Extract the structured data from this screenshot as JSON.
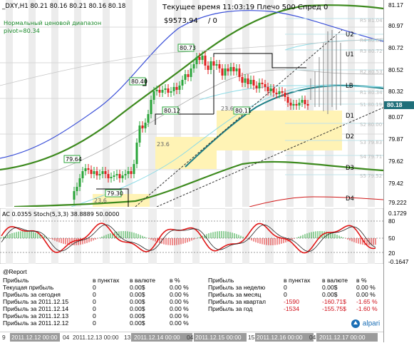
{
  "chart": {
    "symbol_line": "_DXY,H1  80.21 80.16 80.21 80.16 80.18",
    "range_title": "Нормальный ценовой диапазон",
    "pivot": "pivot=80.34",
    "time_line": "Текущее время 11:03:19 Плечо 500 Спред 0",
    "equity": "$9573.94",
    "lots": "/ 0",
    "box_labels": [
      "80.73",
      "80.40",
      "80.12",
      "80.11",
      "79.64",
      "79.30"
    ],
    "fib_labels": [
      "23.6",
      "23.6",
      "23.6"
    ],
    "level_labels": [
      "U2",
      "U1",
      "LB",
      "D1",
      "D2",
      "D3",
      "D4"
    ],
    "right_levels": [
      "R5 81.04",
      "R4 80.86",
      "R3 80.72",
      "R2 80.53",
      "R1 80.34",
      "S1 80.19",
      "S2 80.00",
      "S3 79.83",
      "S4 79.71",
      "S5 79.52"
    ],
    "price_scale": [
      "81.17",
      "80.97",
      "80.72",
      "80.52",
      "80.32",
      "80.07",
      "79.87",
      "79.62",
      "79.42",
      "79.222"
    ],
    "current_price": "80.18"
  },
  "oscillator": {
    "label": "AC 0.0355  Stoch(5,3,3) 38.8889 50.0000",
    "scale": [
      "0.1729",
      "80",
      "50",
      "20",
      "-0.1647"
    ]
  },
  "report": {
    "header": "@Report",
    "col_headers": [
      "в пунктах",
      "в валюте",
      "в %"
    ],
    "left_rows": [
      {
        "label": "Прибыль",
        "pts": "",
        "cur": "",
        "pct": ""
      },
      {
        "label": "Текущая прибыль",
        "pts": "0",
        "cur": "0.00$",
        "pct": "0.00 %"
      },
      {
        "label": "Прибыль за сегодня",
        "pts": "0",
        "cur": "0.00$",
        "pct": "0.00 %"
      },
      {
        "label": "Прибыль за 2011.12.15",
        "pts": "0",
        "cur": "0.00$",
        "pct": "0.00 %"
      },
      {
        "label": "Прибыль за 2011.12.14",
        "pts": "0",
        "cur": "0.00$",
        "pct": "0.00 %"
      },
      {
        "label": "Прибыль за 2011.12.13",
        "pts": "0",
        "cur": "0.00$",
        "pct": "0.00 %"
      },
      {
        "label": "Прибыль за 2011.12.12",
        "pts": "0",
        "cur": "0.00$",
        "pct": "0.00 %"
      }
    ],
    "right_rows": [
      {
        "label": "Прибыль",
        "pts": "",
        "cur": "",
        "pct": ""
      },
      {
        "label": "Прибыль за неделю",
        "pts": "0",
        "cur": "0.00$",
        "pct": "0.00 %"
      },
      {
        "label": "Прибыль за месяц",
        "pts": "0",
        "cur": "0.00$",
        "pct": "0.00 %"
      },
      {
        "label": "Прибыль за квартал",
        "pts": "-1590",
        "cur": "-160.71$",
        "pct": "-1.65 %"
      },
      {
        "label": "Прибыль за год",
        "pts": "-1534",
        "cur": "-155.75$",
        "pct": "-1.60 %"
      }
    ]
  },
  "dates": [
    "9",
    "2011.12.12 00:00",
    "04",
    "2011.12.13 00:00",
    "13",
    "2011.12.14 00:00",
    "04",
    "2011.12.15 00:00",
    "15",
    "2011.12.16 00:00",
    "04",
    "2011.12.17 00:00"
  ],
  "brand": "alpari",
  "colors": {
    "up_candle": "#2aa53a",
    "down_candle": "#e01f1f",
    "ema_dark": "#3d8a1e",
    "ema_blue": "#3a4fd8",
    "ema_teal": "#1d7f86",
    "fib_fill": "#fff3b5",
    "stoch_red": "#e01616"
  }
}
